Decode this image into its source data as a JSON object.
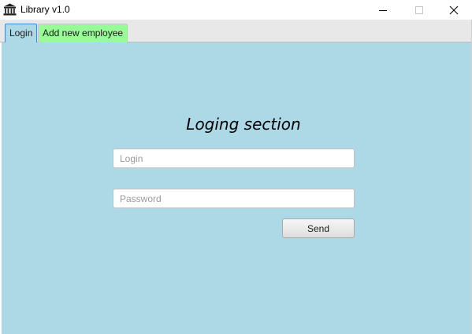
{
  "window": {
    "title": "Library v1.0",
    "app_icon": "library-building-icon",
    "controls": [
      "minimize-icon",
      "maximize-icon",
      "close-icon"
    ]
  },
  "tabs": [
    {
      "label": "Login",
      "selected": true,
      "color": "#add8e6"
    },
    {
      "label": "Add new employee",
      "selected": false,
      "color": "#98fb98"
    }
  ],
  "login_section": {
    "heading": "Loging section",
    "login_field": {
      "value": "",
      "placeholder": "Login"
    },
    "password_field": {
      "value": "",
      "placeholder": "Password"
    },
    "send_label": "Send"
  },
  "colors": {
    "content_background": "#add8e6",
    "tab_add_background": "#98fb98",
    "tab_strip": "#e8e8e8"
  }
}
